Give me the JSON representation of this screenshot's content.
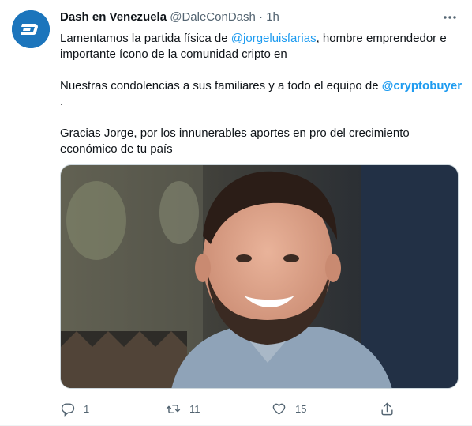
{
  "tweet": {
    "author_name": "Dash en Venezuela",
    "handle": "@DaleConDash",
    "separator": "·",
    "time": "1h",
    "line1_pre": "Lamentamos la partida física de ",
    "line1_mention": "@jorgeluisfarias",
    "line1_post": ", hombre emprendedor e importante ícono de la comunidad cripto en",
    "line2_pre": "Nuestras condolencias a sus familiares y a todo el equipo de ",
    "line2_mention": "@cryptobuyer",
    "line2_post": ".",
    "line3": "Gracias Jorge, por los innunerables aportes en pro del crecimiento económico de tu país",
    "flag_icon": "venezuela-flag-icon",
    "accent_color": "#1d9bf0",
    "brand_color": "#1c75bc"
  },
  "actions": {
    "reply_count": "1",
    "retweet_count": "11",
    "like_count": "15"
  }
}
